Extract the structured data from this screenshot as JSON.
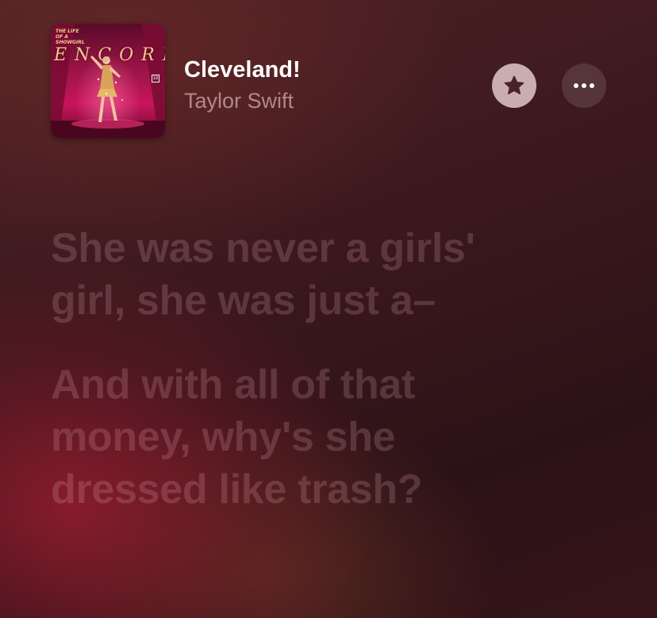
{
  "now_playing": {
    "title": "Cleveland!",
    "artist": "Taylor Swift",
    "artwork": {
      "top_text": "The Life of a Showgirl",
      "main_text": "ENCORE",
      "badge": "18"
    }
  },
  "actions": {
    "favorite_icon": "star-icon",
    "more_icon": "ellipsis-icon"
  },
  "lyrics": [
    {
      "text": "She was never a girls'\ngirl, she was just a–"
    },
    {
      "text": "And with all of that\nmoney, why's she\ndressed like trash?"
    }
  ],
  "colors": {
    "title": "#ffffff",
    "artist": "#c7a6a9",
    "lyric_inactive": "#5e3a40",
    "star_button_bg": "#e8ced0",
    "star_icon": "#4a2328"
  }
}
